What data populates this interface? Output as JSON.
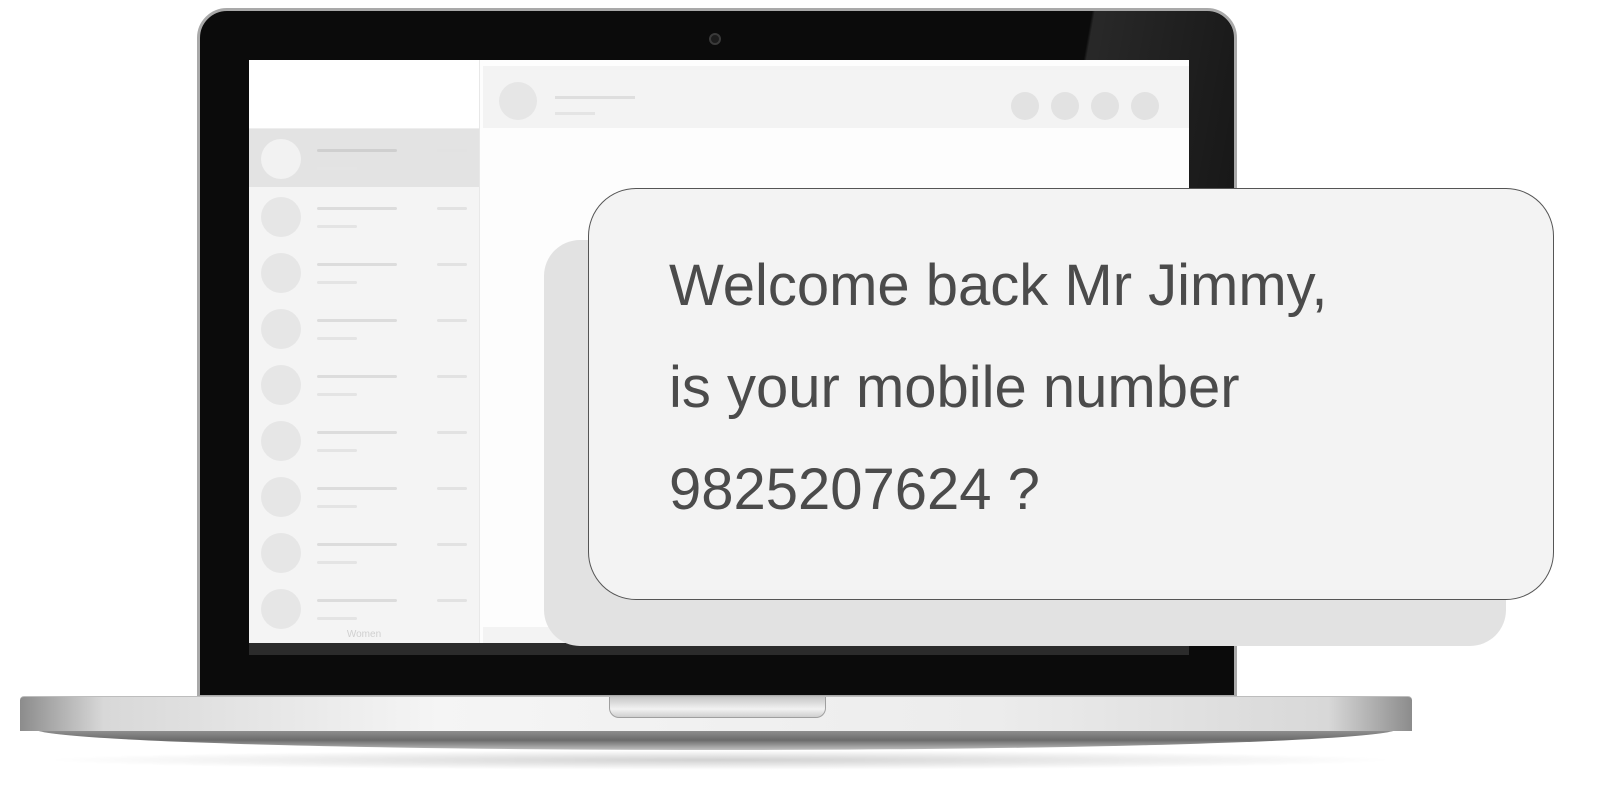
{
  "chat_app": {
    "sidebar_footer_label": "Women",
    "contacts_count_visible": 9
  },
  "message": {
    "line1": "Welcome back Mr Jimmy,",
    "line2": "is your mobile number",
    "line3": "9825207624 ?"
  },
  "colors": {
    "bubble_fill": "#f3f3f3",
    "bubble_text": "#4b4b4b",
    "laptop_bezel": "#0b0b0b"
  }
}
